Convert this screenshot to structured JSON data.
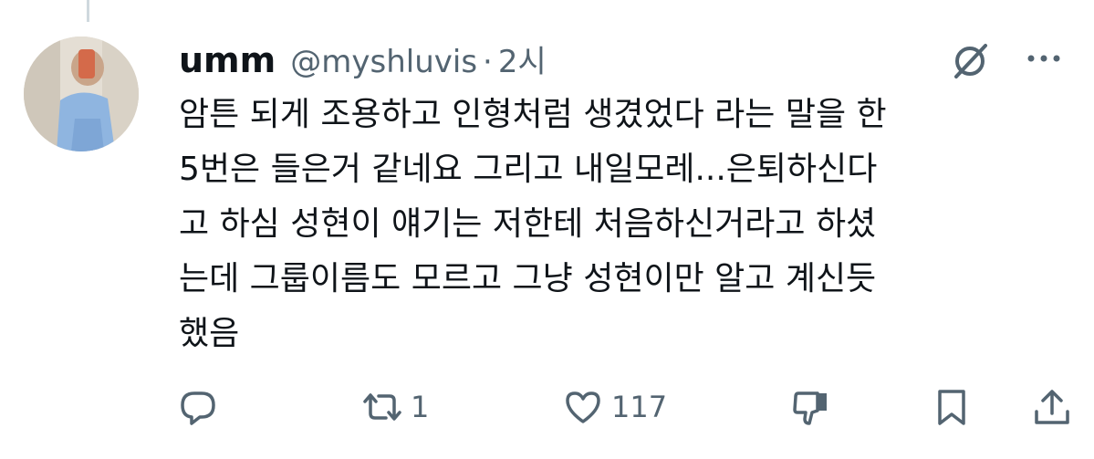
{
  "tweet": {
    "author": {
      "display_name": "umm",
      "handle": "@myshluvis",
      "separator": "·",
      "time": "2시"
    },
    "text": "암튼 되게 조용하고 인형처럼 생겼었다 라는 말을 한\n5번은 들은거 같네요 그리고 내일모레...은퇴하신다\n고 하심 성현이 얘기는 저한테 처음하신거라고 하셨\n는데 그룹이름도 모르고 그냥 성현이만 알고 계신듯\n했음",
    "actions": {
      "reply": {
        "icon": "reply-icon",
        "count": ""
      },
      "retweet": {
        "icon": "retweet-icon",
        "count": "1"
      },
      "like": {
        "icon": "heart-icon",
        "count": "117"
      },
      "downvote": {
        "icon": "downvote-icon"
      },
      "bookmark": {
        "icon": "bookmark-icon"
      },
      "share": {
        "icon": "share-icon"
      }
    },
    "colors": {
      "text": "#0f1419",
      "secondary": "#536471",
      "thread_line": "#cfd9de"
    }
  }
}
